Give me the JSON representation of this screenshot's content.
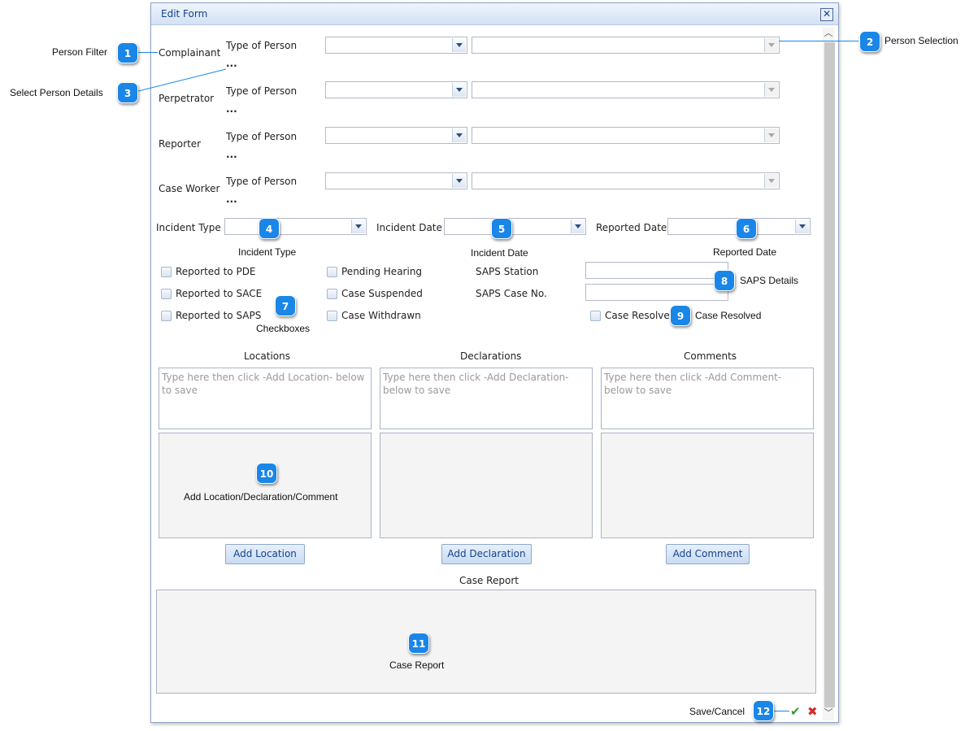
{
  "window": {
    "title": "Edit Form"
  },
  "person_rows": [
    {
      "role": "Complainant",
      "type_label": "Type of Person",
      "ellipsis": "..."
    },
    {
      "role": "Perpetrator",
      "type_label": "Type of Person",
      "ellipsis": "..."
    },
    {
      "role": "Reporter",
      "type_label": "Type of Person",
      "ellipsis": "..."
    },
    {
      "role": "Case Worker",
      "type_label": "Type of Person",
      "ellipsis": "..."
    }
  ],
  "incident": {
    "type_label": "Incident Type",
    "date_label": "Incident Date",
    "reported_label": "Reported Date"
  },
  "checkboxes": {
    "col1": [
      "Reported to PDE",
      "Reported to SACE",
      "Reported to SAPS"
    ],
    "col2": [
      "Pending Hearing",
      "Case Suspended",
      "Case Withdrawn"
    ],
    "case_resolved": "Case Resolved"
  },
  "saps": {
    "station_label": "SAPS Station",
    "case_no_label": "SAPS Case No."
  },
  "panels": {
    "locations": {
      "title": "Locations",
      "placeholder": "Type here then click -Add Location- below to save",
      "button": "Add Location"
    },
    "declarations": {
      "title": "Declarations",
      "placeholder": "Type here then click -Add Declaration- below to save",
      "button": "Add Declaration"
    },
    "comments": {
      "title": "Comments",
      "placeholder": "Type here then click -Add Comment- below to save",
      "button": "Add Comment"
    }
  },
  "case_report": {
    "title": "Case Report"
  },
  "callouts": [
    {
      "num": "1",
      "text": "Person Filter"
    },
    {
      "num": "2",
      "text": "Person Selection"
    },
    {
      "num": "3",
      "text": "Select Person Details"
    },
    {
      "num": "4",
      "text": "Incident Type"
    },
    {
      "num": "5",
      "text": "Incident Date"
    },
    {
      "num": "6",
      "text": "Reported Date"
    },
    {
      "num": "7",
      "text": "Checkboxes"
    },
    {
      "num": "8",
      "text": "SAPS Details"
    },
    {
      "num": "9",
      "text": "Case Resolved"
    },
    {
      "num": "10",
      "text": "Add Location/Declaration/Comment"
    },
    {
      "num": "11",
      "text": "Case Report"
    },
    {
      "num": "12",
      "text": "Save/Cancel"
    }
  ],
  "icons": {
    "close": "close-icon",
    "save": "check-icon",
    "cancel": "cross-icon",
    "scroll_up": "chevron-up-icon",
    "scroll_down": "chevron-down-icon"
  },
  "colors": {
    "callout": "#1a86e8",
    "title_text": "#15428b",
    "save": "#2e9b2e",
    "cancel": "#d42b2b"
  }
}
